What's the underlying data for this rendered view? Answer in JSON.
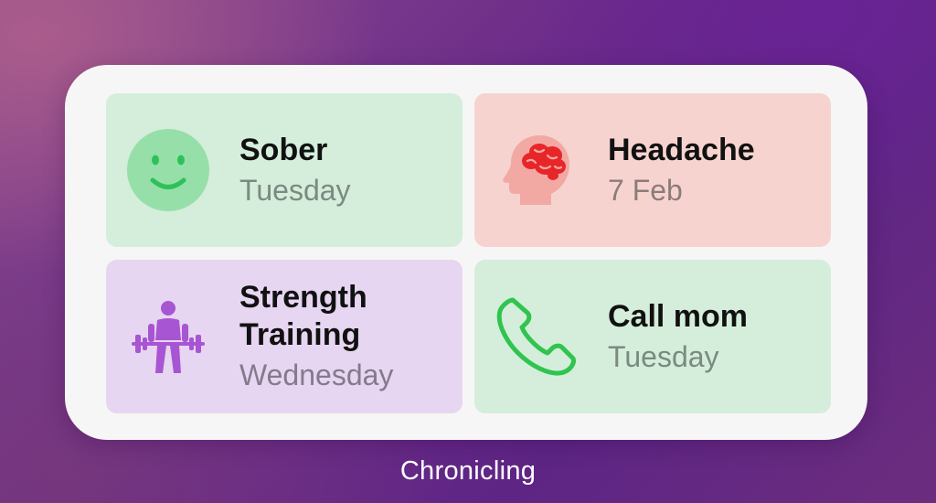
{
  "widget": {
    "tiles": [
      {
        "title": "Sober",
        "subtitle": "Tuesday",
        "icon": "smiley-face-icon",
        "color": "#d4eedb"
      },
      {
        "title": "Headache",
        "subtitle": "7 Feb",
        "icon": "brain-head-icon",
        "color": "#f7d3cf"
      },
      {
        "title": "Strength Training",
        "title_line1": "Strength",
        "title_line2": "Training",
        "subtitle": "Wednesday",
        "icon": "weightlifter-icon",
        "color": "#e6d6f1"
      },
      {
        "title": "Call mom",
        "subtitle": "Tuesday",
        "icon": "phone-icon",
        "color": "#d4eedb"
      }
    ]
  },
  "app_label": "Chronicling",
  "colors": {
    "smiley_green": "#97dfa9",
    "smiley_feature": "#2ec15a",
    "brain_red": "#e8262a",
    "head_pink": "#f2a9a4",
    "lifter_purple": "#a855d3",
    "phone_green": "#30c44f"
  }
}
